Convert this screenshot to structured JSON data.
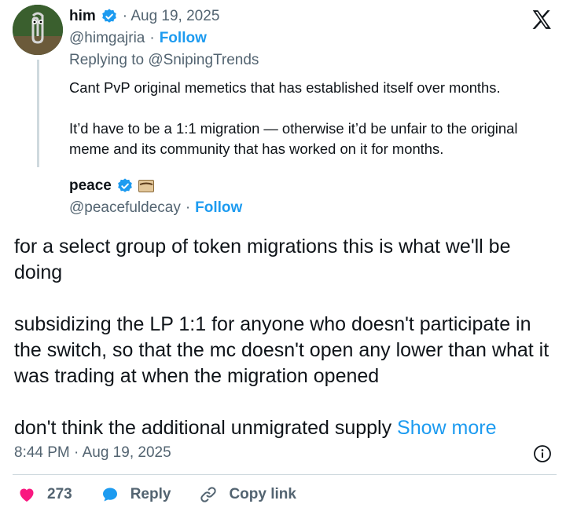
{
  "parent": {
    "name": "him",
    "date": "· Aug 19, 2025",
    "handle": "@himgajria",
    "handle_sep": "·",
    "follow_label": "Follow",
    "replying_to": "Replying to @SnipingTrends",
    "text": "Cant PvP original memetics that has established itself over months.\n\nIt’d have to be a 1:1 migration — otherwise it’d be unfair to the original meme and its community that has worked on it for months."
  },
  "tweet": {
    "name": "peace",
    "handle": "@peacefuldecay",
    "handle_sep": "·",
    "follow_label": "Follow",
    "text": "for a select group of token migrations this is what we'll be doing\n\nsubsidizing the LP 1:1 for anyone who doesn't participate in the switch, so that the mc doesn't open any lower than what it was trading at when the migration opened\n\ndon't think the additional unmigrated supply ",
    "show_more": "Show more",
    "timestamp": "8:44 PM · Aug 19, 2025"
  },
  "actions": {
    "like_count": "273",
    "reply_label": "Reply",
    "copy_link_label": "Copy link"
  },
  "colors": {
    "accent": "#1d9bf0",
    "like": "#f91880",
    "muted": "#536471",
    "text": "#0f1419"
  },
  "icons": [
    "x-logo-icon",
    "verified-badge-icon",
    "envelope-emoji-icon",
    "info-icon",
    "heart-icon",
    "reply-bubble-icon",
    "link-icon"
  ]
}
